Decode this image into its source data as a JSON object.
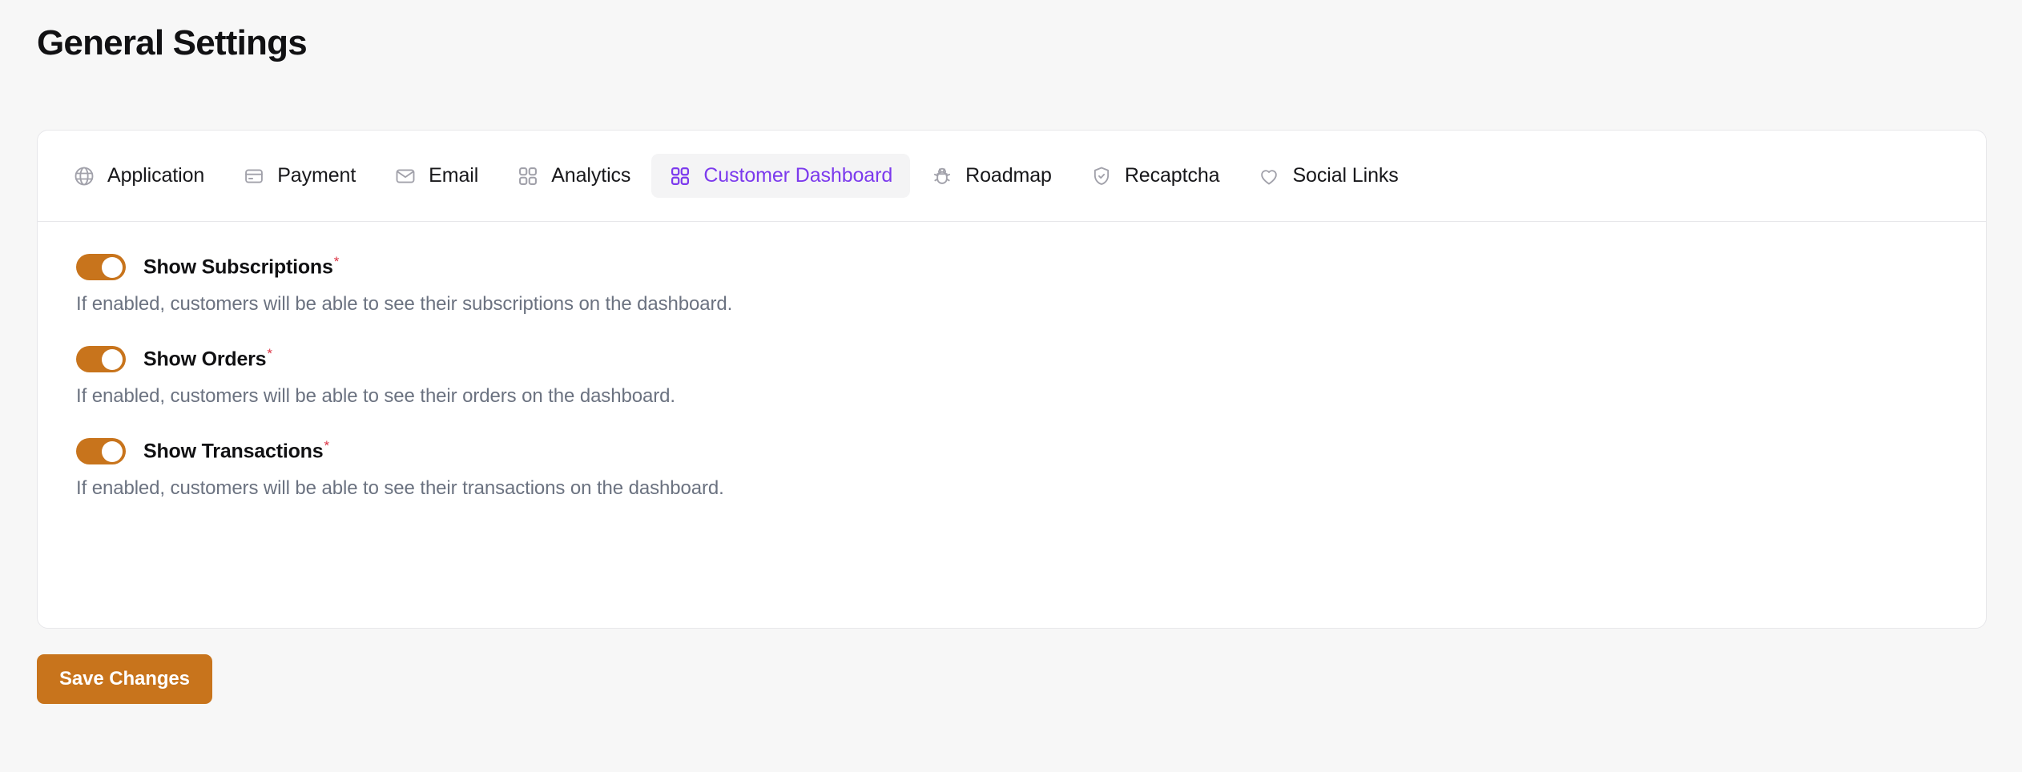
{
  "page": {
    "title": "General Settings",
    "background_color": "#f7f7f7"
  },
  "theme": {
    "accent_orange": "#c8741c",
    "active_tab_purple": "#7c3aed",
    "required_red": "#dc3545",
    "muted_text": "#6b7280",
    "card_border": "#e7e7ea",
    "active_tab_background": "#f4f4f5"
  },
  "tabs": [
    {
      "id": "application",
      "label": "Application",
      "icon": "globe-icon",
      "active": false
    },
    {
      "id": "payment",
      "label": "Payment",
      "icon": "credit-card-icon",
      "active": false
    },
    {
      "id": "email",
      "label": "Email",
      "icon": "envelope-icon",
      "active": false
    },
    {
      "id": "analytics",
      "label": "Analytics",
      "icon": "grid-icon",
      "active": false
    },
    {
      "id": "customer-dashboard",
      "label": "Customer Dashboard",
      "icon": "grid-icon",
      "active": true
    },
    {
      "id": "roadmap",
      "label": "Roadmap",
      "icon": "bug-icon",
      "active": false
    },
    {
      "id": "recaptcha",
      "label": "Recaptcha",
      "icon": "shield-check-icon",
      "active": false
    },
    {
      "id": "social-links",
      "label": "Social Links",
      "icon": "heart-icon",
      "active": false
    }
  ],
  "settings": [
    {
      "id": "show-subscriptions",
      "label": "Show Subscriptions",
      "required_marker": "*",
      "enabled": true,
      "description": "If enabled, customers will be able to see their subscriptions on the dashboard."
    },
    {
      "id": "show-orders",
      "label": "Show Orders",
      "required_marker": "*",
      "enabled": true,
      "description": "If enabled, customers will be able to see their orders on the dashboard."
    },
    {
      "id": "show-transactions",
      "label": "Show Transactions",
      "required_marker": "*",
      "enabled": true,
      "description": "If enabled, customers will be able to see their transactions on the dashboard."
    }
  ],
  "footer": {
    "save_label": "Save Changes"
  }
}
